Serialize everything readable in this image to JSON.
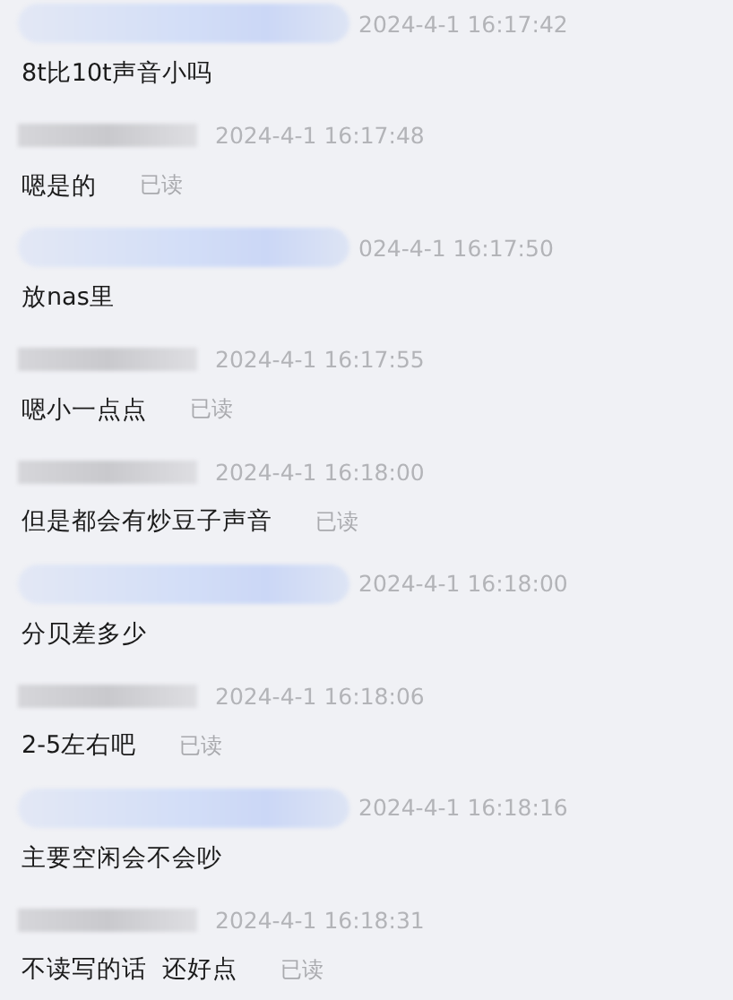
{
  "messages": [
    {
      "kind": "peer",
      "time": "2024-4-1 16:17:42",
      "text": "8t比10t声音小吗"
    },
    {
      "kind": "self",
      "time": "2024-4-1 16:17:48",
      "text": "嗯是的",
      "status": "已读"
    },
    {
      "kind": "peer",
      "time": "024-4-1 16:17:50",
      "text": "放nas里"
    },
    {
      "kind": "self",
      "time": "2024-4-1 16:17:55",
      "text": "嗯小一点点",
      "status": "已读"
    },
    {
      "kind": "self",
      "time": "2024-4-1 16:18:00",
      "text": "但是都会有炒豆子声音",
      "status": "已读"
    },
    {
      "kind": "peer",
      "time": "2024-4-1 16:18:00",
      "text": "分贝差多少"
    },
    {
      "kind": "self",
      "time": "2024-4-1 16:18:06",
      "text": "2-5左右吧",
      "status": "已读"
    },
    {
      "kind": "peer",
      "time": "2024-4-1 16:18:16",
      "text": "主要空闲会不会吵"
    },
    {
      "kind": "self",
      "time": "2024-4-1 16:18:31",
      "text": "不读写的话  还好点",
      "status": "已读"
    }
  ]
}
